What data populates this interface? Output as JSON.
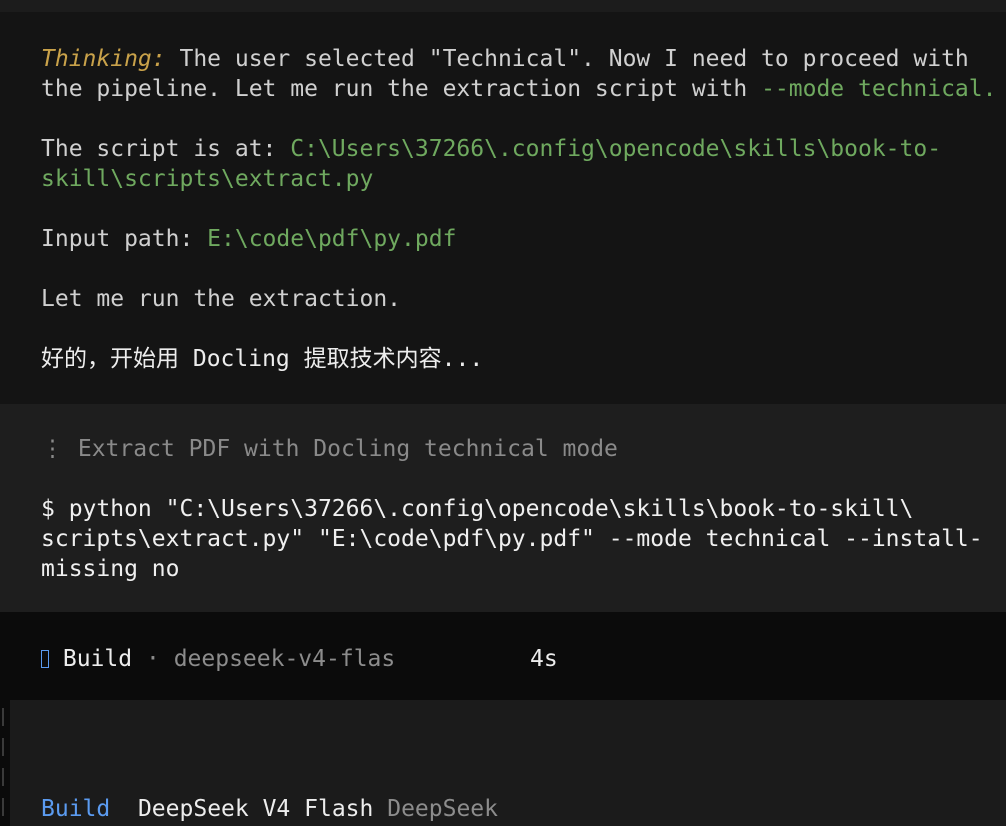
{
  "reasoning": {
    "thinking_label": "Thinking:",
    "line1_rest": " The user selected \"Technical\". Now I need to proceed with",
    "line2_prefix": "the pipeline. Let me run the extraction script with ",
    "line2_flag": "--mode technical.",
    "script_label": "The script is at: ",
    "script_path_line1": "C:\\Users\\37266\\.config\\opencode\\skills\\book-to-",
    "script_path_line2": "skill\\scripts\\extract.py",
    "input_label": "Input path: ",
    "input_path": "E:\\code\\pdf\\py.pdf",
    "run_line": "Let me run the extraction.",
    "chinese_prefix": "好的，开始用 Docling 提取技术内容",
    "chinese_ellipsis": "..."
  },
  "tool": {
    "glyph": "⋮",
    "title": "Extract PDF with Docling technical mode",
    "command_line1": "$ python \"C:\\Users\\37266\\.config\\opencode\\skills\\book-to-skill\\",
    "command_line2": "scripts\\extract.py\" \"E:\\code\\pdf\\py.pdf\" --mode technical --install-",
    "command_line3": "missing no"
  },
  "status": {
    "icon": "build-glyph-icon",
    "agent": "Build",
    "separator": "·",
    "model": "deepseek-v4-flas",
    "duration": "4s"
  },
  "prompt": {
    "agent": "Build",
    "model": "DeepSeek V4 Flash",
    "provider": "DeepSeek"
  },
  "colors": {
    "accent_blue": "#5b9bf0",
    "path_green": "#6fa95f",
    "thinking_gold": "#c9a24a"
  }
}
